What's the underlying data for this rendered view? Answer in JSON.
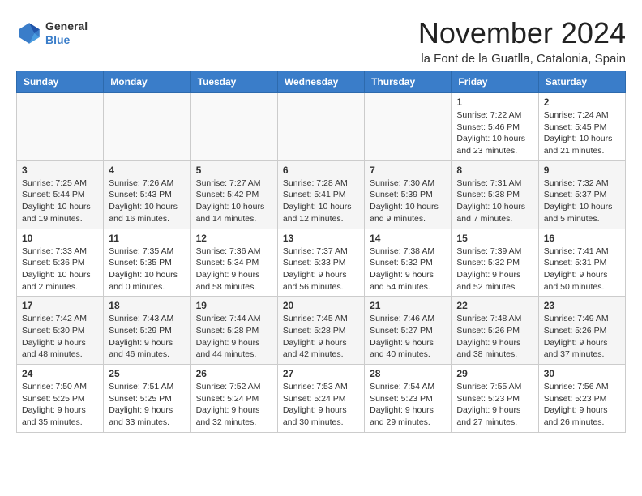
{
  "header": {
    "logo_line1": "General",
    "logo_line2": "Blue",
    "month_title": "November 2024",
    "location": "la Font de la Guatlla, Catalonia, Spain"
  },
  "days_of_week": [
    "Sunday",
    "Monday",
    "Tuesday",
    "Wednesday",
    "Thursday",
    "Friday",
    "Saturday"
  ],
  "weeks": [
    [
      {
        "day": "",
        "info": ""
      },
      {
        "day": "",
        "info": ""
      },
      {
        "day": "",
        "info": ""
      },
      {
        "day": "",
        "info": ""
      },
      {
        "day": "",
        "info": ""
      },
      {
        "day": "1",
        "info": "Sunrise: 7:22 AM\nSunset: 5:46 PM\nDaylight: 10 hours and 23 minutes."
      },
      {
        "day": "2",
        "info": "Sunrise: 7:24 AM\nSunset: 5:45 PM\nDaylight: 10 hours and 21 minutes."
      }
    ],
    [
      {
        "day": "3",
        "info": "Sunrise: 7:25 AM\nSunset: 5:44 PM\nDaylight: 10 hours and 19 minutes."
      },
      {
        "day": "4",
        "info": "Sunrise: 7:26 AM\nSunset: 5:43 PM\nDaylight: 10 hours and 16 minutes."
      },
      {
        "day": "5",
        "info": "Sunrise: 7:27 AM\nSunset: 5:42 PM\nDaylight: 10 hours and 14 minutes."
      },
      {
        "day": "6",
        "info": "Sunrise: 7:28 AM\nSunset: 5:41 PM\nDaylight: 10 hours and 12 minutes."
      },
      {
        "day": "7",
        "info": "Sunrise: 7:30 AM\nSunset: 5:39 PM\nDaylight: 10 hours and 9 minutes."
      },
      {
        "day": "8",
        "info": "Sunrise: 7:31 AM\nSunset: 5:38 PM\nDaylight: 10 hours and 7 minutes."
      },
      {
        "day": "9",
        "info": "Sunrise: 7:32 AM\nSunset: 5:37 PM\nDaylight: 10 hours and 5 minutes."
      }
    ],
    [
      {
        "day": "10",
        "info": "Sunrise: 7:33 AM\nSunset: 5:36 PM\nDaylight: 10 hours and 2 minutes."
      },
      {
        "day": "11",
        "info": "Sunrise: 7:35 AM\nSunset: 5:35 PM\nDaylight: 10 hours and 0 minutes."
      },
      {
        "day": "12",
        "info": "Sunrise: 7:36 AM\nSunset: 5:34 PM\nDaylight: 9 hours and 58 minutes."
      },
      {
        "day": "13",
        "info": "Sunrise: 7:37 AM\nSunset: 5:33 PM\nDaylight: 9 hours and 56 minutes."
      },
      {
        "day": "14",
        "info": "Sunrise: 7:38 AM\nSunset: 5:32 PM\nDaylight: 9 hours and 54 minutes."
      },
      {
        "day": "15",
        "info": "Sunrise: 7:39 AM\nSunset: 5:32 PM\nDaylight: 9 hours and 52 minutes."
      },
      {
        "day": "16",
        "info": "Sunrise: 7:41 AM\nSunset: 5:31 PM\nDaylight: 9 hours and 50 minutes."
      }
    ],
    [
      {
        "day": "17",
        "info": "Sunrise: 7:42 AM\nSunset: 5:30 PM\nDaylight: 9 hours and 48 minutes."
      },
      {
        "day": "18",
        "info": "Sunrise: 7:43 AM\nSunset: 5:29 PM\nDaylight: 9 hours and 46 minutes."
      },
      {
        "day": "19",
        "info": "Sunrise: 7:44 AM\nSunset: 5:28 PM\nDaylight: 9 hours and 44 minutes."
      },
      {
        "day": "20",
        "info": "Sunrise: 7:45 AM\nSunset: 5:28 PM\nDaylight: 9 hours and 42 minutes."
      },
      {
        "day": "21",
        "info": "Sunrise: 7:46 AM\nSunset: 5:27 PM\nDaylight: 9 hours and 40 minutes."
      },
      {
        "day": "22",
        "info": "Sunrise: 7:48 AM\nSunset: 5:26 PM\nDaylight: 9 hours and 38 minutes."
      },
      {
        "day": "23",
        "info": "Sunrise: 7:49 AM\nSunset: 5:26 PM\nDaylight: 9 hours and 37 minutes."
      }
    ],
    [
      {
        "day": "24",
        "info": "Sunrise: 7:50 AM\nSunset: 5:25 PM\nDaylight: 9 hours and 35 minutes."
      },
      {
        "day": "25",
        "info": "Sunrise: 7:51 AM\nSunset: 5:25 PM\nDaylight: 9 hours and 33 minutes."
      },
      {
        "day": "26",
        "info": "Sunrise: 7:52 AM\nSunset: 5:24 PM\nDaylight: 9 hours and 32 minutes."
      },
      {
        "day": "27",
        "info": "Sunrise: 7:53 AM\nSunset: 5:24 PM\nDaylight: 9 hours and 30 minutes."
      },
      {
        "day": "28",
        "info": "Sunrise: 7:54 AM\nSunset: 5:23 PM\nDaylight: 9 hours and 29 minutes."
      },
      {
        "day": "29",
        "info": "Sunrise: 7:55 AM\nSunset: 5:23 PM\nDaylight: 9 hours and 27 minutes."
      },
      {
        "day": "30",
        "info": "Sunrise: 7:56 AM\nSunset: 5:23 PM\nDaylight: 9 hours and 26 minutes."
      }
    ]
  ]
}
